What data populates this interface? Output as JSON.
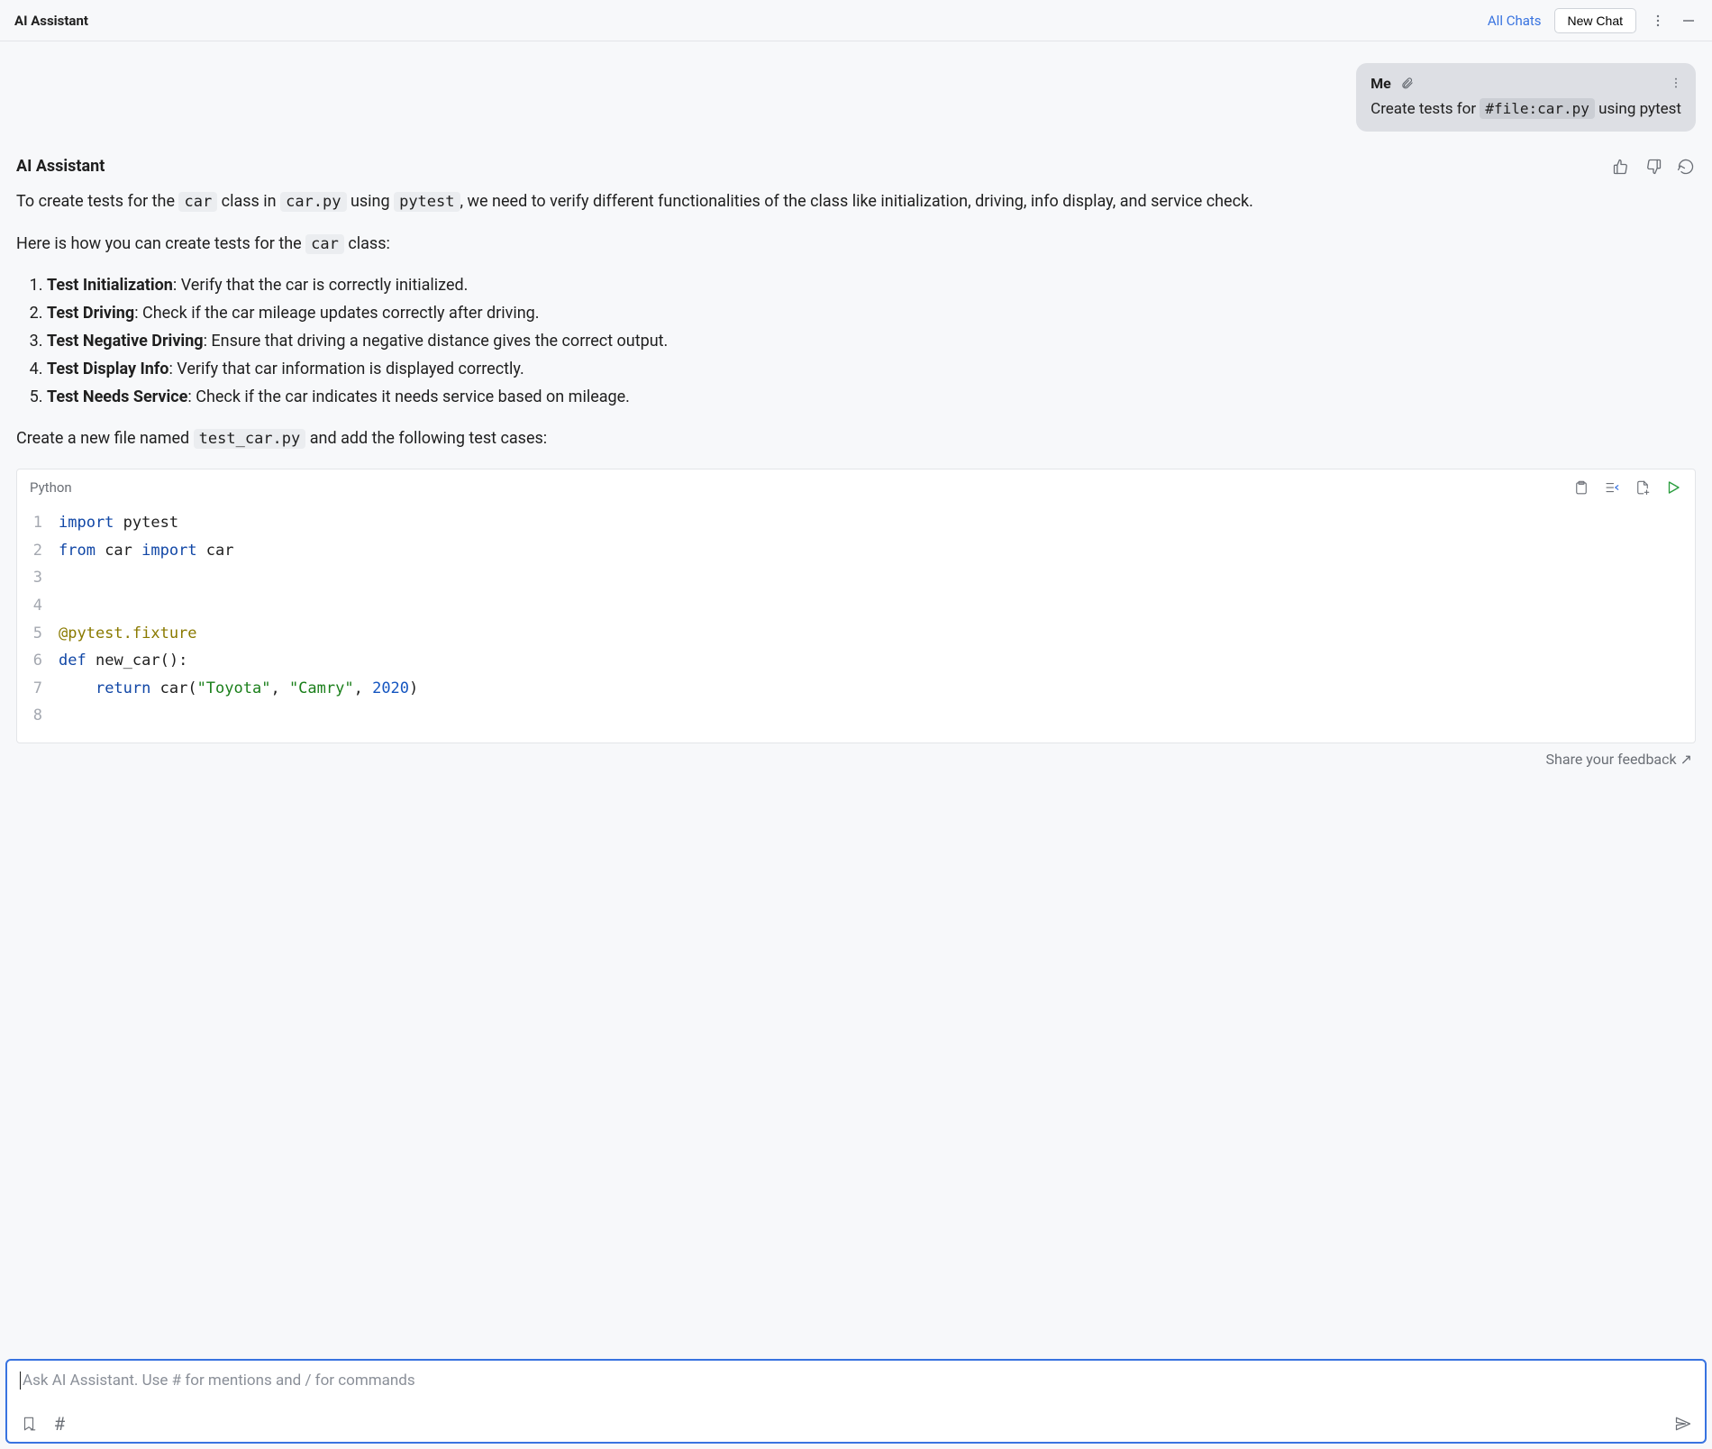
{
  "header": {
    "title": "AI Assistant",
    "all_chats": "All Chats",
    "new_chat": "New Chat"
  },
  "user_message": {
    "author": "Me",
    "text_before": "Create tests for ",
    "chip": "#file:car.py",
    "text_after": " using pytest"
  },
  "assistant_message": {
    "title": "AI Assistant",
    "para1_a": "To create tests for the ",
    "para1_code1": "car",
    "para1_b": " class in ",
    "para1_code2": "car.py",
    "para1_c": " using ",
    "para1_code3": "pytest",
    "para1_d": ", we need to verify different functionalities of the class like initialization, driving, info display, and service check.",
    "para2_a": "Here is how you can create tests for the ",
    "para2_code1": "car",
    "para2_b": " class:",
    "tests": [
      {
        "t": "Test Initialization",
        "d": ": Verify that the car is correctly initialized."
      },
      {
        "t": "Test Driving",
        "d": ": Check if the car mileage updates correctly after driving."
      },
      {
        "t": "Test Negative Driving",
        "d": ": Ensure that driving a negative distance gives the correct output."
      },
      {
        "t": "Test Display Info",
        "d": ": Verify that car information is displayed correctly."
      },
      {
        "t": "Test Needs Service",
        "d": ": Check if the car indicates it needs service based on mileage."
      }
    ],
    "para3_a": "Create a new file named ",
    "para3_code1": "test_car.py",
    "para3_b": " and add the following test cases:"
  },
  "code": {
    "lang": "Python",
    "lines": [
      [
        {
          "c": "tok-kw",
          "t": "import"
        },
        {
          "c": "",
          "t": " pytest"
        }
      ],
      [
        {
          "c": "tok-kw",
          "t": "from"
        },
        {
          "c": "",
          "t": " car "
        },
        {
          "c": "tok-kw",
          "t": "import"
        },
        {
          "c": "",
          "t": " car"
        }
      ],
      [],
      [],
      [
        {
          "c": "tok-dec",
          "t": "@pytest.fixture"
        }
      ],
      [
        {
          "c": "tok-kw",
          "t": "def"
        },
        {
          "c": "",
          "t": " "
        },
        {
          "c": "tok-fn",
          "t": "new_car"
        },
        {
          "c": "",
          "t": "():"
        }
      ],
      [
        {
          "c": "",
          "t": "    "
        },
        {
          "c": "tok-kw",
          "t": "return"
        },
        {
          "c": "",
          "t": " car("
        },
        {
          "c": "tok-str",
          "t": "\"Toyota\""
        },
        {
          "c": "",
          "t": ", "
        },
        {
          "c": "tok-str",
          "t": "\"Camry\""
        },
        {
          "c": "",
          "t": ", "
        },
        {
          "c": "tok-num",
          "t": "2020"
        },
        {
          "c": "",
          "t": ")"
        }
      ],
      []
    ]
  },
  "feedback": "Share your feedback ↗",
  "input": {
    "placeholder": "Ask AI Assistant. Use # for mentions and / for commands"
  },
  "icons": {
    "attach": "attach-icon",
    "more": "more-icon",
    "minimize": "minimize-icon",
    "thumbs_up": "thumbs-up-icon",
    "thumbs_down": "thumbs-down-icon",
    "regenerate": "regenerate-icon",
    "copy": "clipboard-icon",
    "insert": "insert-lines-icon",
    "newfile": "new-file-icon",
    "run": "run-icon",
    "bookmark": "bookmark-icon",
    "hash": "#",
    "send": "send-icon"
  }
}
